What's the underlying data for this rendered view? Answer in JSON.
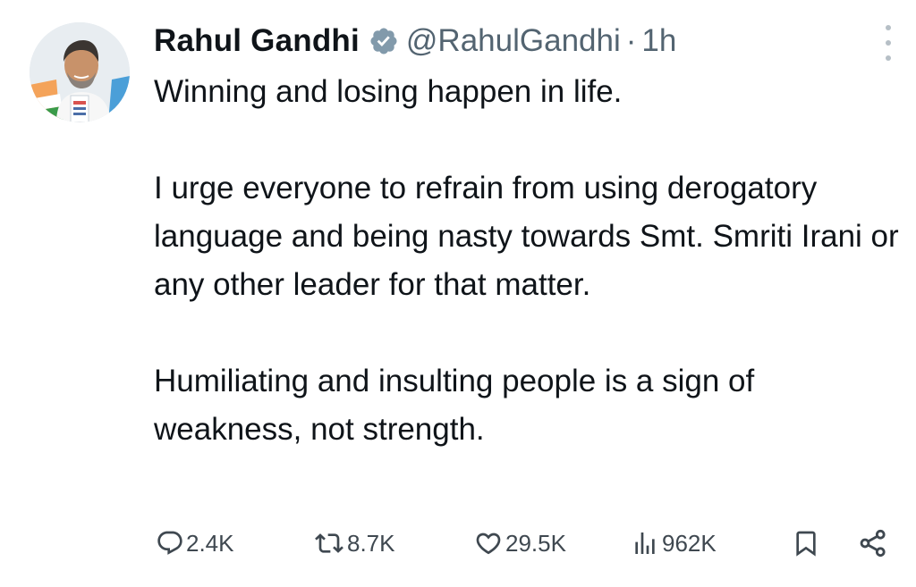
{
  "tweet": {
    "author_name": "Rahul Gandhi",
    "verified_icon": "verified-badge-icon",
    "handle": "@RahulGandhi",
    "separator": "·",
    "time": "1h",
    "more_icon": "more-vertical-icon",
    "paragraphs": [
      "Winning and losing happen in life.",
      "I urge everyone to refrain from using derogatory language and being nasty towards Smt. Smriti Irani or any other leader for that matter.",
      "Humiliating and insulting people is a sign of weakness, not strength."
    ]
  },
  "actions": {
    "replies": {
      "icon": "reply-icon",
      "count": "2.4K"
    },
    "reposts": {
      "icon": "repost-icon",
      "count": "8.7K"
    },
    "likes": {
      "icon": "heart-icon",
      "count": "29.5K"
    },
    "views": {
      "icon": "views-icon",
      "count": "962K"
    },
    "bookmark": {
      "icon": "bookmark-icon"
    },
    "share": {
      "icon": "share-icon"
    }
  },
  "colors": {
    "text": "#0f1419",
    "secondary": "#536471",
    "verified_badge": "#829aab"
  }
}
